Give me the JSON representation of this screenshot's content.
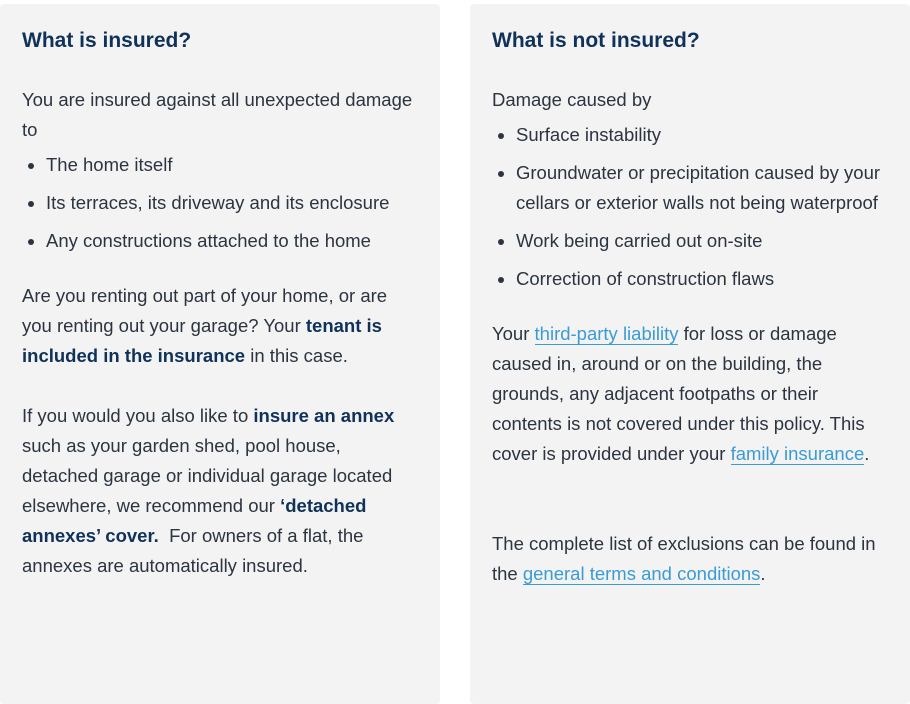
{
  "insured": {
    "title": "What is insured?",
    "intro": "You are insured against all unexpected damage to",
    "items": [
      "The home itself",
      "Its terraces, its driveway and its enclosure",
      "Any constructions attached to the home"
    ],
    "renting": {
      "text1": "Are you renting out part of your home, or are you renting out your garage? Your ",
      "bold": "tenant is included in the insurance",
      "text2": " in this case."
    },
    "annex": {
      "text1": "If you would you also like to ",
      "bold1": "insure an annex",
      "text2": " such as your garden shed, pool house, detached garage or individual garage located elsewhere, we recommend our ",
      "bold2": "‘detached annexes’ cover.",
      "text3": "  For owners of a flat, the annexes are automatically insured."
    }
  },
  "not_insured": {
    "title": "What is not insured?",
    "intro": "Damage caused by",
    "items": [
      "Surface instability",
      "Groundwater or precipitation caused by your cellars or exterior walls not being waterproof",
      "Work being carried out on-site",
      "Correction of construction flaws"
    ],
    "liability": {
      "text1": "Your ",
      "link1": "third-party liability",
      "text2": " for loss or damage caused in, around or on the building, the grounds, any adjacent footpaths or their contents is not covered under this policy. This cover is provided under your ",
      "link2": "family insurance",
      "text3": "."
    },
    "exclusions": {
      "text1": "The complete list of exclusions can be found in the ",
      "link": "general terms and conditions",
      "text2": "."
    }
  }
}
